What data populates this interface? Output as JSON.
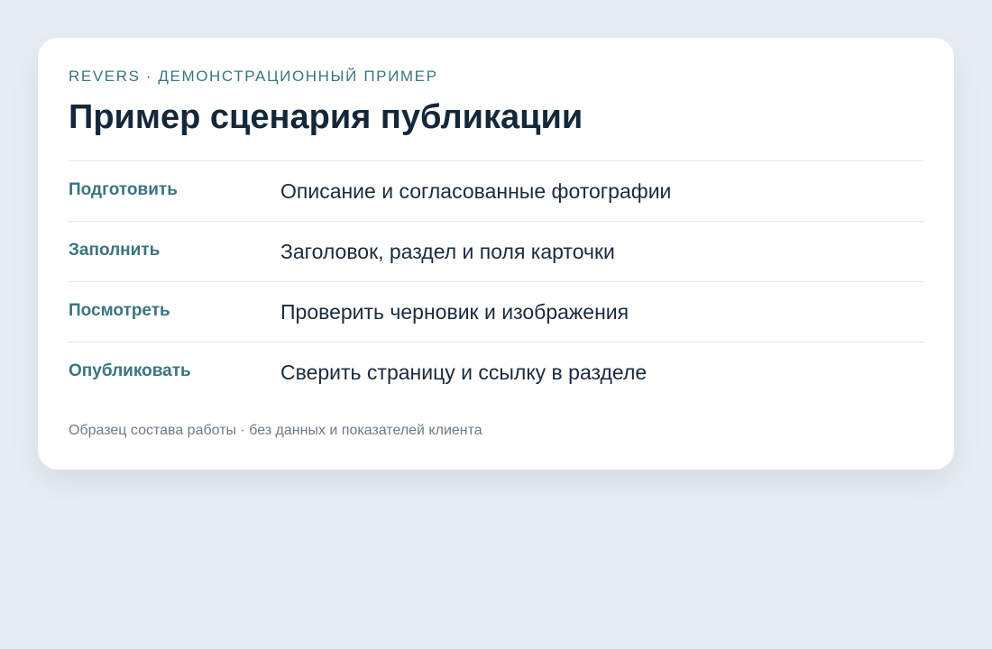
{
  "card": {
    "eyebrow": "REVERS · ДЕМОНСТРАЦИОННЫЙ ПРИМЕР",
    "title": "Пример сценария публикации",
    "steps": [
      {
        "label": "Подготовить",
        "description": "Описание и согласованные фотографии"
      },
      {
        "label": "Заполнить",
        "description": "Заголовок, раздел и поля карточки"
      },
      {
        "label": "Посмотреть",
        "description": "Проверить черновик и изображения"
      },
      {
        "label": "Опубликовать",
        "description": "Сверить страницу и ссылку в разделе"
      }
    ],
    "footnote": "Образец состава работы · без данных и показателей клиента"
  },
  "colors": {
    "background": "#e8edf4",
    "card": "#ffffff",
    "accent": "#3a7580",
    "heading": "#14283a",
    "text": "#1a2b3c",
    "muted": "#6b7a88",
    "divider": "#e3e7ec"
  }
}
